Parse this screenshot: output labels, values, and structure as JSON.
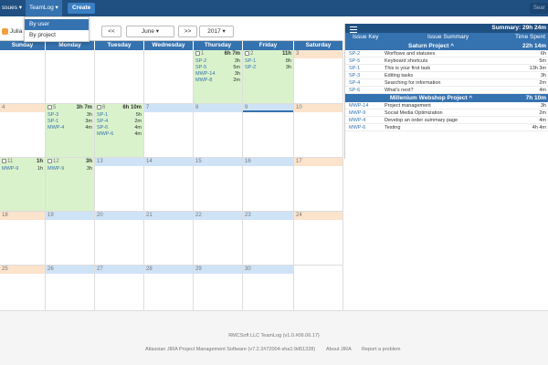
{
  "topbar": {
    "issues_label": "ssues ▾",
    "teamlog_label": "TeamLog ▾",
    "create_label": "Create",
    "search_placeholder": "Sear"
  },
  "dropdown": {
    "items": [
      "By user",
      "By project"
    ]
  },
  "toolbar": {
    "user": "Julia",
    "prev": "<<",
    "month": "June ▾",
    "next": ">>",
    "year": "2017 ▾"
  },
  "calendar": {
    "days": [
      "Sunday",
      "Monday",
      "Tuesday",
      "Wednesday",
      "Thursday",
      "Friday",
      "Saturday"
    ],
    "weeks": [
      [
        {
          "num": "",
          "tot": "",
          "logs": []
        },
        {
          "num": "",
          "tot": "",
          "logs": []
        },
        {
          "num": "",
          "tot": "",
          "logs": []
        },
        {
          "num": "",
          "tot": "",
          "logs": []
        },
        {
          "num": "1",
          "tot": "6h 7m",
          "cb": true,
          "green": true,
          "logs": [
            [
              "SP-2",
              "3h"
            ],
            [
              "SP-5",
              "5m"
            ],
            [
              "MWP-14",
              "3h"
            ],
            [
              "MWP-8",
              "2m"
            ]
          ]
        },
        {
          "num": "2",
          "tot": "11h",
          "cb": true,
          "green": true,
          "logs": [
            [
              "SP-1",
              "8h"
            ],
            [
              "SP-2",
              "3h"
            ]
          ]
        },
        {
          "num": "3",
          "tot": "",
          "weekend": true,
          "logs": []
        }
      ],
      [
        {
          "num": "4",
          "tot": "",
          "weekend": true,
          "logs": []
        },
        {
          "num": "5",
          "tot": "3h 7m",
          "cb": true,
          "green": true,
          "logs": [
            [
              "SP-3",
              "3h"
            ],
            [
              "SP-1",
              "3m"
            ],
            [
              "MWP-4",
              "4m"
            ]
          ]
        },
        {
          "num": "6",
          "tot": "6h 10m",
          "cb": true,
          "green": true,
          "logs": [
            [
              "SP-1",
              "5h"
            ],
            [
              "SP-4",
              "2m"
            ],
            [
              "SP-6",
              "4m"
            ],
            [
              "MWP-6",
              "4m"
            ]
          ]
        },
        {
          "num": "7",
          "tot": "",
          "blue": true,
          "logs": []
        },
        {
          "num": "8",
          "tot": "",
          "blue": true,
          "logs": []
        },
        {
          "num": "9",
          "tot": "",
          "blue": true,
          "today": true,
          "logs": []
        },
        {
          "num": "10",
          "tot": "",
          "weekend": true,
          "logs": []
        }
      ],
      [
        {
          "num": "11",
          "tot": "1h",
          "cb": true,
          "green": true,
          "logs": [
            [
              "MWP-9",
              "1h"
            ]
          ]
        },
        {
          "num": "12",
          "tot": "3h",
          "cb": true,
          "green": true,
          "logs": [
            [
              "MWP-9",
              "3h"
            ]
          ]
        },
        {
          "num": "13",
          "tot": "",
          "blue": true,
          "logs": []
        },
        {
          "num": "14",
          "tot": "",
          "blue": true,
          "logs": []
        },
        {
          "num": "15",
          "tot": "",
          "blue": true,
          "logs": []
        },
        {
          "num": "16",
          "tot": "",
          "blue": true,
          "logs": []
        },
        {
          "num": "17",
          "tot": "",
          "weekend": true,
          "logs": []
        }
      ],
      [
        {
          "num": "18",
          "tot": "",
          "weekend": true,
          "logs": []
        },
        {
          "num": "19",
          "tot": "",
          "blue": true,
          "logs": []
        },
        {
          "num": "20",
          "tot": "",
          "blue": true,
          "logs": []
        },
        {
          "num": "21",
          "tot": "",
          "blue": true,
          "logs": []
        },
        {
          "num": "22",
          "tot": "",
          "blue": true,
          "logs": []
        },
        {
          "num": "23",
          "tot": "",
          "blue": true,
          "logs": []
        },
        {
          "num": "24",
          "tot": "",
          "weekend": true,
          "logs": []
        }
      ],
      [
        {
          "num": "25",
          "tot": "",
          "weekend": true,
          "logs": []
        },
        {
          "num": "26",
          "tot": "",
          "blue": true,
          "logs": []
        },
        {
          "num": "27",
          "tot": "",
          "blue": true,
          "logs": []
        },
        {
          "num": "28",
          "tot": "",
          "blue": true,
          "logs": []
        },
        {
          "num": "29",
          "tot": "",
          "blue": true,
          "logs": []
        },
        {
          "num": "30",
          "tot": "",
          "blue": true,
          "logs": []
        },
        {
          "num": "",
          "tot": "",
          "logs": []
        }
      ]
    ]
  },
  "summary": {
    "title": "Summary: 29h 24m",
    "col_key": "Issue Key",
    "col_summary": "Issue Summary",
    "col_time": "Time Spent",
    "projects": [
      {
        "name": "Saturn Project ^",
        "time": "22h 14m",
        "issues": [
          [
            "SP-2",
            "Worflows and statuses",
            "6h"
          ],
          [
            "SP-5",
            "Keyboard shortcuts",
            "5m"
          ],
          [
            "SP-1",
            "This is your first task",
            "13h 3m"
          ],
          [
            "SP-3",
            "Editing tasks",
            "3h"
          ],
          [
            "SP-4",
            "Searching for information",
            "2m"
          ],
          [
            "SP-6",
            "What's next?",
            "4m"
          ]
        ]
      },
      {
        "name": "Millenium Webshop Project ^",
        "time": "7h 10m",
        "issues": [
          [
            "MWP-14",
            "Project management",
            "3h"
          ],
          [
            "MWP-9",
            "Social Media Optimization",
            "2m"
          ],
          [
            "MWP-4",
            "Develop an order summary page",
            "4m"
          ],
          [
            "MWP-6",
            "Testing",
            "4h 4m"
          ]
        ]
      }
    ]
  },
  "footer": {
    "line1": "RMCSoft LLC TeamLog (v1.0.#06.06.17)",
    "jira": "Atlassian JIRA Project Management Software (v7.2.2#72004-sha1:9d51328)",
    "about": "About JIRA",
    "report": "Report a problem"
  },
  "colors": {
    "header": "#205081",
    "accent": "#3572b0",
    "green": "#d9f2cb",
    "blue": "#cfe3f7",
    "weekend": "#fbe3cc"
  }
}
